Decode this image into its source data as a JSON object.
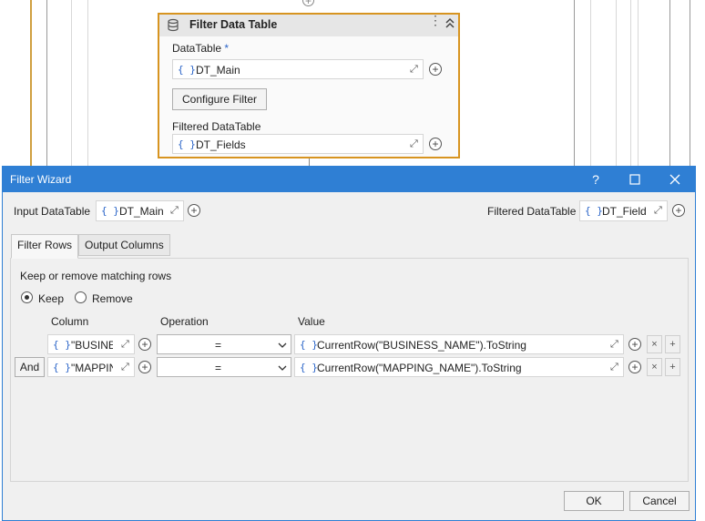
{
  "card": {
    "title": "Filter Data Table",
    "datatable_label": "DataTable",
    "required_mark": "*",
    "datatable_value": "DT_Main",
    "configure_label": "Configure Filter",
    "filtered_label": "Filtered DataTable",
    "filtered_value": "DT_Fields"
  },
  "dialog": {
    "title": "Filter Wizard",
    "help": "?",
    "input_label": "Input DataTable",
    "input_value": "DT_Main",
    "filtered_label": "Filtered DataTable",
    "filtered_value": "DT_Fields",
    "tabs": [
      "Filter Rows",
      "Output Columns"
    ],
    "mode_text": "Keep or remove matching rows",
    "keep_label": "Keep",
    "remove_label": "Remove",
    "columns": {
      "column": "Column",
      "operation": "Operation",
      "value": "Value"
    },
    "rows": [
      {
        "joiner": "",
        "column": "\"BUSINE",
        "operation": "=",
        "value": "CurrentRow(\"BUSINESS_NAME\").ToString"
      },
      {
        "joiner": "And",
        "column": "\"MAPPIN",
        "operation": "=",
        "value": "CurrentRow(\"MAPPING_NAME\").ToString"
      }
    ],
    "ok_label": "OK",
    "cancel_label": "Cancel"
  },
  "icons": {
    "brace": "{ }",
    "expand": "⤢",
    "plus": "+",
    "close_small": "×"
  },
  "colors": {
    "accent": "#2f7fd4",
    "selection": "#d79420",
    "brace": "#2a64c8"
  }
}
